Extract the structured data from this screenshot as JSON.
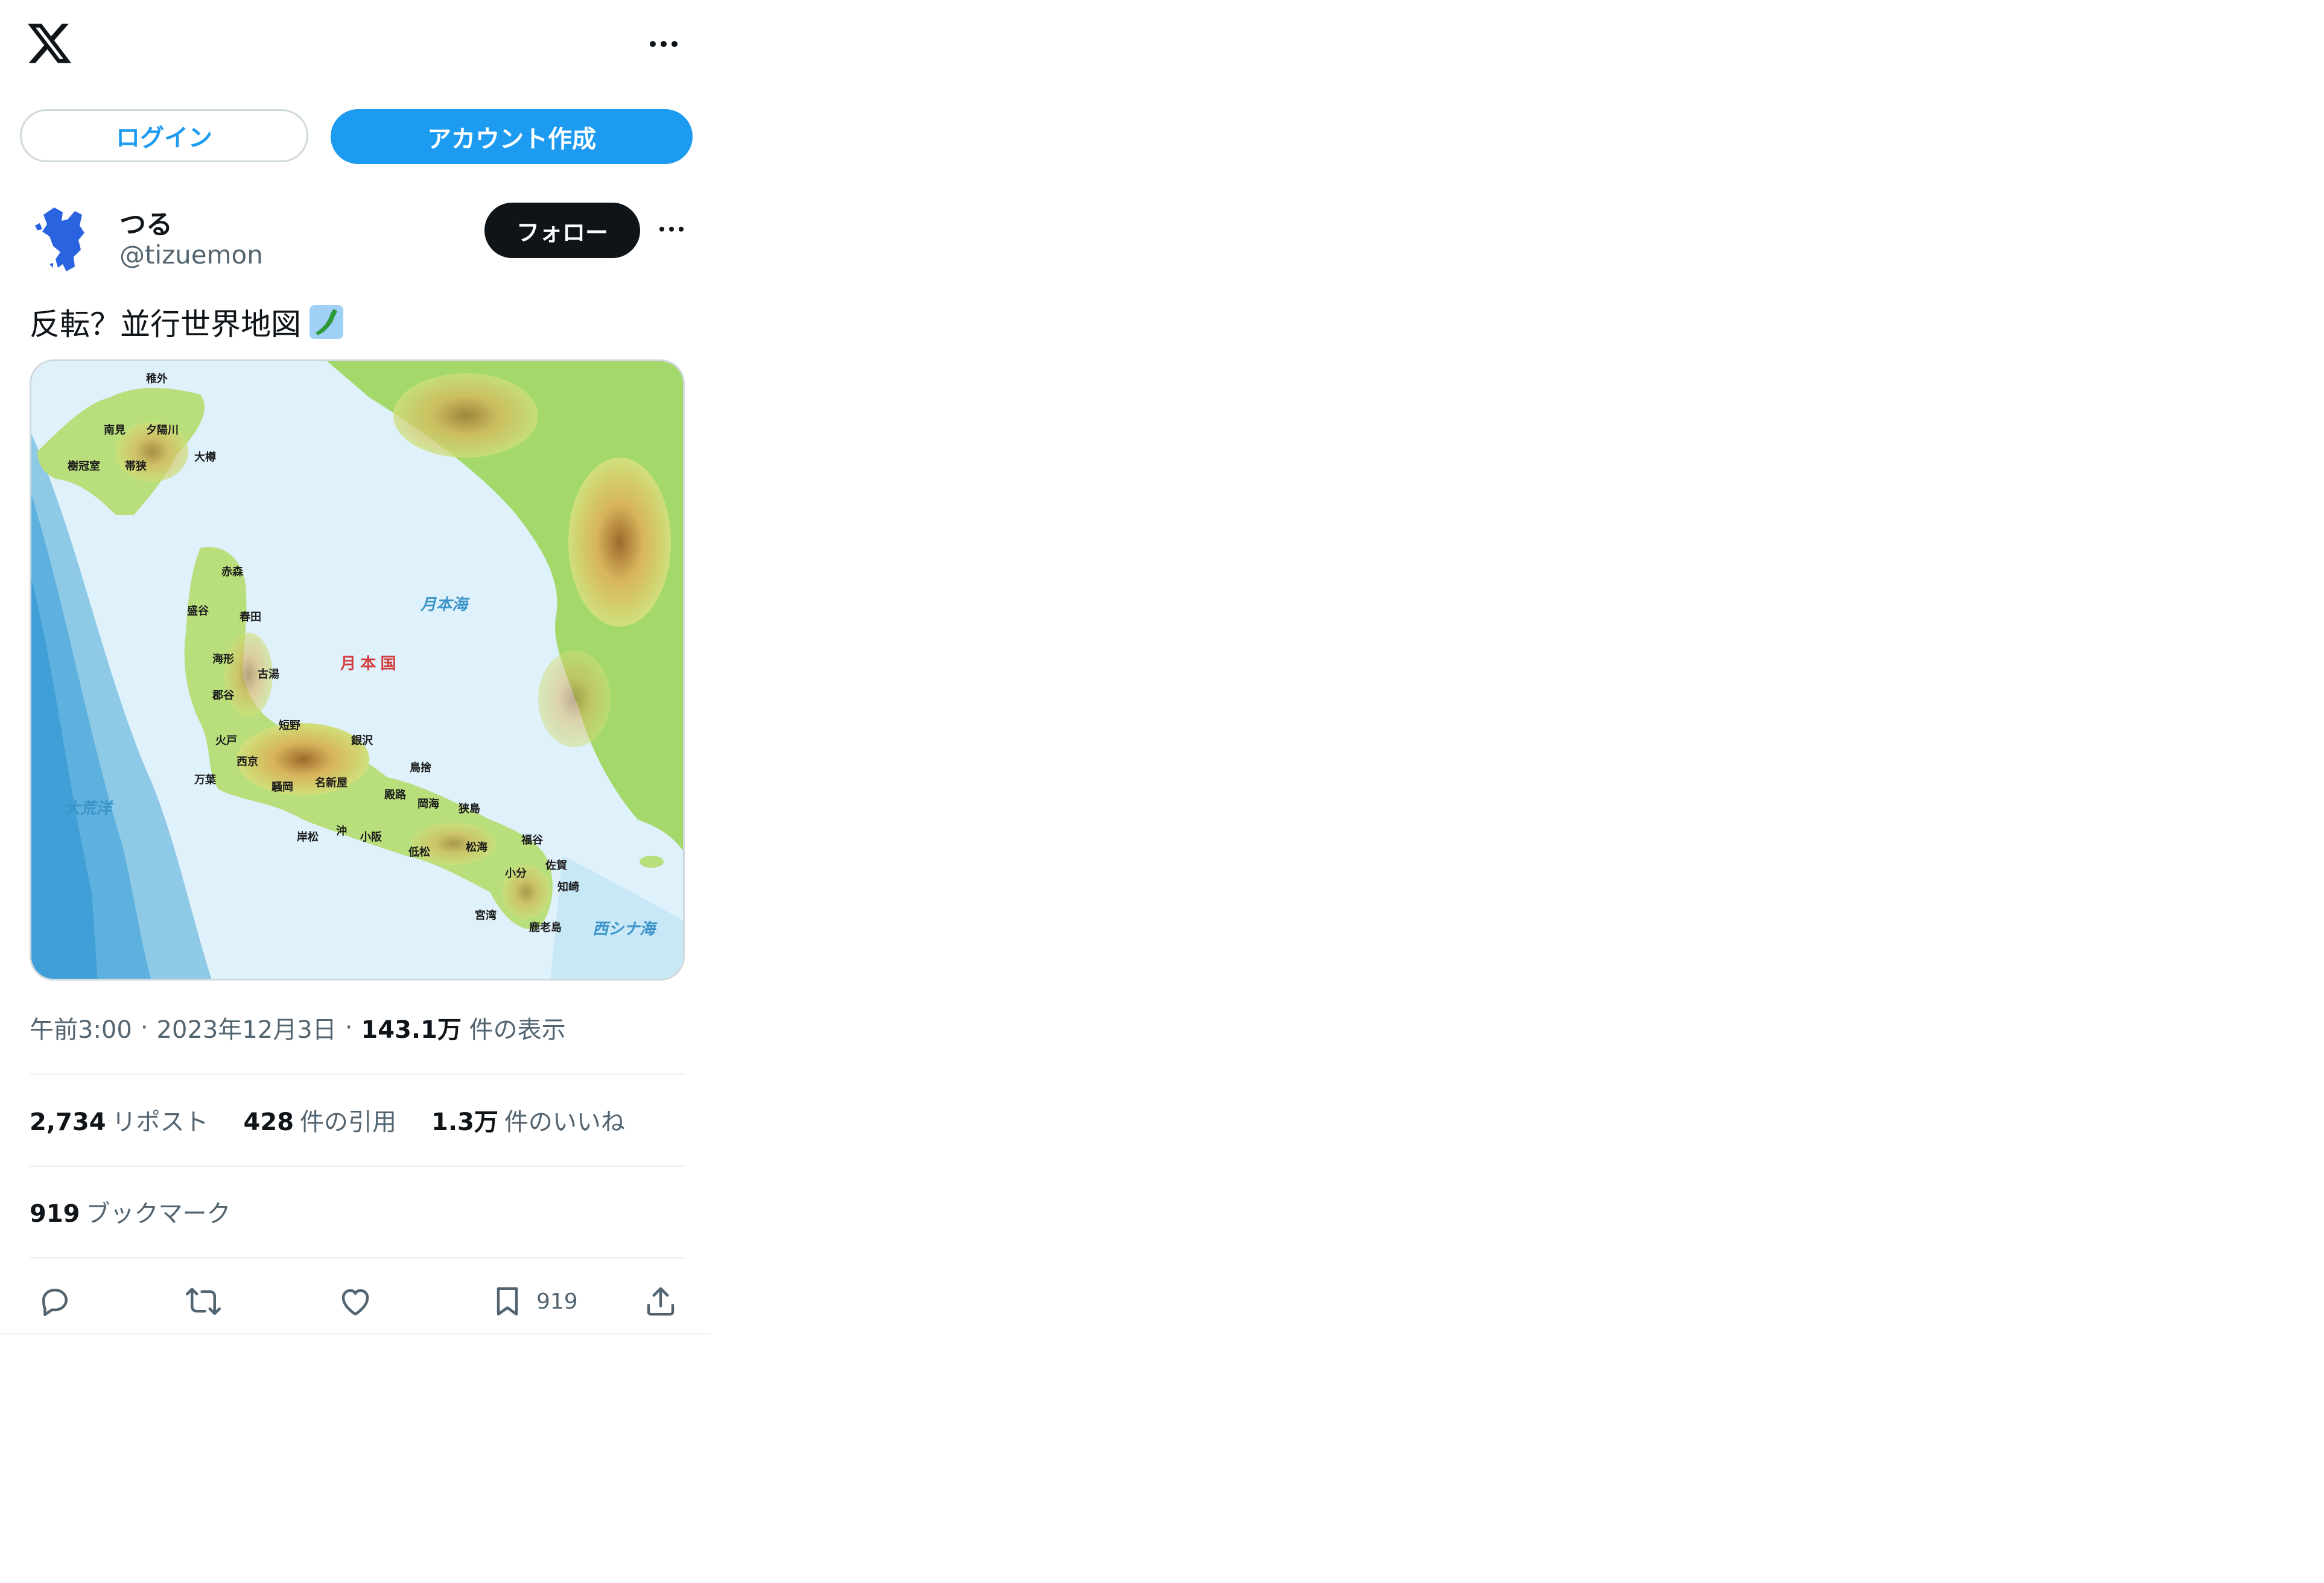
{
  "header": {
    "login_label": "ログイン",
    "signup_label": "アカウント作成"
  },
  "post": {
    "display_name": "つる",
    "handle": "@tizuemon",
    "follow_label": "フォロー",
    "text": "反転？並行世界地図",
    "meta": {
      "time": "午前3:00",
      "date": "2023年12月3日",
      "separator": "·",
      "views_value": "143.1万",
      "views_label": "件の表示"
    },
    "stats": {
      "reposts_value": "2,734",
      "reposts_label": "リポスト",
      "quotes_value": "428",
      "quotes_label": "件の引用",
      "likes_value": "1.3万",
      "likes_label": "件のいいね",
      "bookmarks_value": "919",
      "bookmarks_label": "ブックマーク"
    },
    "actions": {
      "bookmark_count": "919"
    },
    "map_labels": {
      "sea_north": "月本海",
      "country": "月 本 国",
      "ocean_west": "大荒洋",
      "sea_south": "西シナ海",
      "cities": [
        "稚外",
        "南見",
        "夕陽川",
        "樹冠室",
        "帯狭",
        "大樽",
        "赤森",
        "盛谷",
        "春田",
        "海形",
        "古湯",
        "郡谷",
        "短野",
        "銀沢",
        "火戸",
        "西京",
        "名新屋",
        "万葉",
        "騒岡",
        "鳥捨",
        "殿路",
        "岡海",
        "狭島",
        "岸松",
        "沖",
        "小阪",
        "低松",
        "松海",
        "福谷",
        "小分",
        "佐賀",
        "知崎",
        "宮湾",
        "鹿老島"
      ]
    }
  },
  "colors": {
    "accent": "#1d9bf0",
    "dark": "#0f1419",
    "muted": "#536471",
    "border": "#cfd9de"
  },
  "icons": [
    "x-logo-icon",
    "more-icon",
    "reply-icon",
    "repost-icon",
    "like-icon",
    "bookmark-icon",
    "share-icon"
  ]
}
